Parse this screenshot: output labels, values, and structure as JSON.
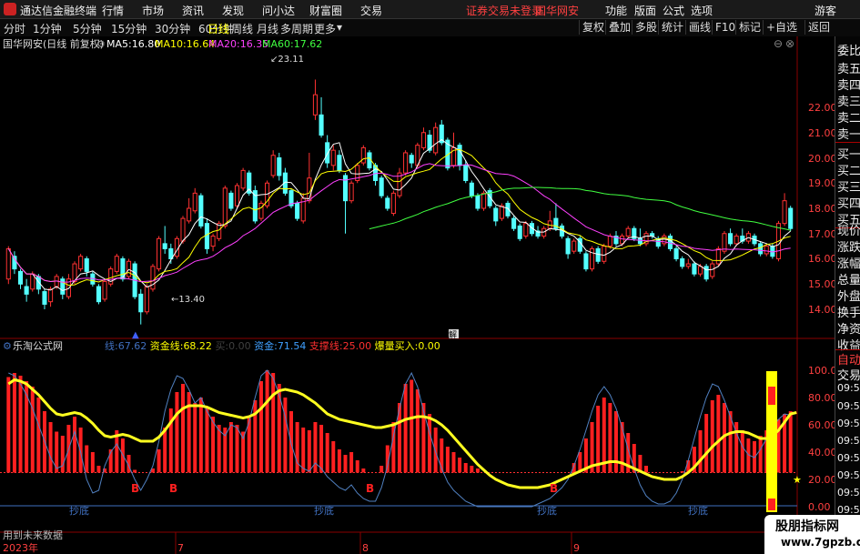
{
  "menubar": {
    "app_title": "通达信金融终端",
    "menus": [
      "行情",
      "市场",
      "资讯",
      "发现",
      "问小达",
      "财富圈",
      "交易"
    ],
    "warning": "证券交易未登录",
    "stock": "国华网安",
    "right_items": [
      "功能",
      "版面",
      "公式",
      "选项"
    ],
    "guest": "游客"
  },
  "periods": [
    "分时",
    "1分钟",
    "5分钟",
    "15分钟",
    "30分钟",
    "60分钟",
    "日线",
    "周线",
    "月线",
    "多周期",
    "更多"
  ],
  "active_period": "日线",
  "tools": [
    "复权",
    "叠加",
    "多股",
    "统计",
    "画线",
    "F10",
    "标记",
    "+自选",
    "返回"
  ],
  "main_panel": {
    "title": "国华网安(日线 前复权)",
    "ma": [
      {
        "label": "MA5:",
        "value": "16.80",
        "color": "#ffffff"
      },
      {
        "label": "MA10:",
        "value": "16.64",
        "color": "#ffff00"
      },
      {
        "label": "MA20:",
        "value": "16.35",
        "color": "#ff40ff"
      },
      {
        "label": "MA60:",
        "value": "17.62",
        "color": "#40ff40"
      }
    ],
    "high_label": "23.11",
    "low_label": "13.40",
    "marker": "解",
    "axis_ticks": [
      "22.00",
      "21.00",
      "20.00",
      "19.00",
      "18.00",
      "17.00",
      "16.00",
      "15.00",
      "14.00"
    ]
  },
  "sub_panel": {
    "title": "乐淘公式网",
    "indicators": [
      {
        "label": "线:",
        "value": "67.62",
        "color": "#4070c0"
      },
      {
        "label": "资金线:",
        "value": "68.22",
        "color": "#ffff00"
      },
      {
        "label": "买:",
        "value": "0.00",
        "color": "#404040"
      },
      {
        "label": "资金:",
        "value": "71.54",
        "color": "#40a0ff"
      },
      {
        "label": "支撑线:",
        "value": "25.00",
        "color": "#ff3030"
      },
      {
        "label": "爆量买入:",
        "value": "0.00",
        "color": "#ffff00"
      }
    ],
    "axis_ticks": [
      "100.00",
      "80.00",
      "60.00",
      "40.00",
      "20.00",
      "0.00"
    ],
    "b_marks": [
      "B",
      "B",
      "B",
      "B"
    ],
    "bottom_labels": [
      "抄底",
      "抄底",
      "抄底",
      "抄底"
    ],
    "future_note": "用到未来数据"
  },
  "time_axis": [
    "2023年",
    "7",
    "8",
    "9"
  ],
  "sidebar": {
    "items": [
      "委比",
      "卖五",
      "卖四",
      "卖三",
      "卖二",
      "卖一",
      "买一",
      "买二",
      "买三",
      "买四",
      "买五",
      "现价",
      "涨跌",
      "涨幅",
      "总量",
      "外盘",
      "换手",
      "净资",
      "收益"
    ],
    "lower": [
      "自动",
      "交易",
      "09:51",
      "09:51",
      "09:51",
      "09:51",
      "09:52",
      "09:52",
      "09:52",
      "09:52"
    ]
  },
  "watermark": {
    "line1": "股朋指标网",
    "line2": "www.7gpzb.com"
  },
  "chart_data": {
    "type": "candlestick",
    "candles": [
      [
        15.2,
        16.4,
        15.0,
        16.5
      ],
      [
        16.1,
        15.6,
        15.4,
        16.3
      ],
      [
        15.5,
        15.0,
        14.8,
        15.6
      ],
      [
        14.9,
        14.6,
        14.3,
        15.2
      ],
      [
        14.8,
        15.4,
        14.7,
        15.5
      ],
      [
        15.3,
        14.8,
        14.6,
        15.4
      ],
      [
        14.7,
        14.2,
        14.0,
        14.8
      ],
      [
        14.3,
        14.8,
        14.1,
        14.9
      ],
      [
        14.9,
        15.3,
        14.8,
        15.4
      ],
      [
        15.2,
        14.6,
        14.4,
        15.3
      ],
      [
        14.5,
        15.2,
        14.4,
        15.4
      ],
      [
        15.1,
        15.8,
        15.0,
        15.9
      ],
      [
        15.6,
        16.1,
        15.5,
        16.2
      ],
      [
        16.0,
        15.5,
        15.3,
        16.1
      ],
      [
        15.4,
        15.0,
        14.9,
        15.5
      ],
      [
        14.9,
        14.3,
        14.2,
        15.0
      ],
      [
        14.4,
        15.1,
        14.3,
        15.2
      ],
      [
        15.0,
        15.6,
        14.9,
        15.7
      ],
      [
        15.5,
        16.1,
        15.4,
        16.2
      ],
      [
        16.0,
        15.2,
        15.1,
        16.1
      ],
      [
        15.3,
        15.9,
        15.2,
        16.0
      ],
      [
        15.8,
        14.5,
        14.4,
        15.9
      ],
      [
        14.6,
        13.9,
        13.4,
        14.8
      ],
      [
        13.9,
        14.9,
        13.8,
        15.0
      ],
      [
        14.8,
        15.7,
        14.7,
        15.8
      ],
      [
        15.6,
        16.8,
        15.5,
        16.9
      ],
      [
        16.6,
        16.4,
        16.2,
        17.3
      ],
      [
        16.4,
        16.0,
        15.8,
        16.6
      ],
      [
        16.1,
        16.8,
        16.0,
        16.9
      ],
      [
        16.7,
        17.6,
        16.6,
        17.7
      ],
      [
        17.5,
        18.0,
        17.4,
        18.4
      ],
      [
        17.9,
        18.6,
        17.8,
        18.8
      ],
      [
        18.5,
        17.3,
        17.2,
        18.6
      ],
      [
        17.4,
        16.4,
        16.2,
        17.6
      ],
      [
        16.5,
        16.9,
        16.3,
        17.0
      ],
      [
        16.8,
        17.4,
        16.7,
        17.5
      ],
      [
        17.3,
        18.8,
        17.2,
        18.9
      ],
      [
        18.6,
        18.0,
        17.9,
        18.7
      ],
      [
        18.1,
        18.9,
        18.0,
        19.0
      ],
      [
        18.8,
        19.5,
        18.7,
        19.6
      ],
      [
        19.4,
        18.6,
        18.5,
        19.5
      ],
      [
        18.7,
        17.5,
        17.4,
        18.9
      ],
      [
        17.6,
        18.2,
        17.5,
        18.3
      ],
      [
        18.1,
        19.0,
        18.0,
        19.1
      ],
      [
        19.3,
        20.1,
        19.2,
        20.3
      ],
      [
        20.0,
        19.3,
        19.1,
        20.2
      ],
      [
        19.4,
        18.6,
        18.5,
        19.6
      ],
      [
        18.7,
        18.1,
        18.0,
        18.8
      ],
      [
        18.2,
        17.6,
        17.5,
        18.3
      ],
      [
        17.5,
        18.4,
        17.4,
        18.6
      ],
      [
        18.3,
        19.2,
        18.2,
        20.2
      ],
      [
        21.7,
        22.5,
        21.5,
        23.1
      ],
      [
        21.7,
        20.9,
        20.8,
        22.4
      ],
      [
        20.6,
        19.8,
        19.6,
        20.9
      ],
      [
        19.7,
        20.3,
        19.5,
        20.5
      ],
      [
        20.1,
        19.5,
        19.4,
        20.3
      ],
      [
        19.3,
        18.3,
        17.0,
        19.4
      ],
      [
        18.3,
        19.0,
        18.2,
        19.1
      ],
      [
        19.1,
        19.7,
        19.0,
        19.8
      ],
      [
        19.8,
        20.4,
        19.7,
        20.5
      ],
      [
        20.2,
        19.6,
        19.5,
        20.3
      ],
      [
        19.7,
        19.1,
        18.9,
        19.8
      ],
      [
        19.2,
        18.5,
        18.4,
        19.3
      ],
      [
        18.4,
        18.0,
        17.9,
        18.5
      ],
      [
        17.8,
        18.6,
        17.7,
        18.7
      ],
      [
        18.5,
        19.4,
        18.4,
        19.6
      ],
      [
        19.4,
        20.2,
        19.3,
        20.3
      ],
      [
        20.1,
        19.8,
        19.6,
        20.2
      ],
      [
        19.7,
        20.5,
        19.6,
        20.6
      ],
      [
        20.4,
        21.0,
        20.3,
        21.2
      ],
      [
        20.9,
        20.3,
        20.2,
        21.1
      ],
      [
        20.2,
        21.2,
        20.1,
        21.4
      ],
      [
        21.3,
        20.6,
        20.5,
        21.5
      ],
      [
        20.7,
        19.6,
        19.5,
        20.8
      ],
      [
        19.7,
        20.4,
        19.6,
        21.0
      ],
      [
        20.5,
        19.7,
        19.5,
        20.6
      ],
      [
        19.7,
        19.1,
        19.0,
        19.9
      ],
      [
        19.0,
        18.5,
        18.4,
        19.1
      ],
      [
        18.5,
        18.0,
        17.9,
        18.6
      ],
      [
        18.0,
        18.6,
        17.9,
        18.7
      ],
      [
        18.7,
        18.1,
        18.0,
        18.8
      ],
      [
        18.0,
        17.5,
        17.3,
        18.1
      ],
      [
        17.6,
        18.1,
        17.5,
        18.2
      ],
      [
        18.2,
        17.7,
        17.6,
        18.3
      ],
      [
        17.6,
        17.2,
        17.1,
        17.7
      ],
      [
        17.3,
        16.8,
        16.7,
        17.4
      ],
      [
        16.9,
        17.4,
        16.8,
        17.5
      ],
      [
        17.4,
        17.0,
        16.9,
        17.5
      ],
      [
        17.1,
        16.9,
        16.8,
        17.3
      ],
      [
        16.9,
        17.2,
        16.8,
        17.3
      ],
      [
        17.2,
        17.5,
        17.1,
        17.9
      ],
      [
        17.6,
        17.2,
        17.1,
        18.2
      ],
      [
        17.3,
        16.9,
        16.8,
        17.4
      ],
      [
        16.8,
        16.2,
        16.0,
        16.9
      ],
      [
        16.3,
        16.7,
        16.2,
        16.8
      ],
      [
        16.8,
        16.3,
        16.2,
        16.9
      ],
      [
        16.2,
        15.6,
        15.5,
        16.3
      ],
      [
        15.6,
        16.4,
        15.5,
        16.5
      ],
      [
        16.4,
        15.9,
        15.8,
        16.5
      ],
      [
        15.9,
        16.5,
        15.8,
        16.6
      ],
      [
        16.5,
        16.9,
        16.4,
        17.0
      ],
      [
        16.9,
        16.6,
        16.5,
        17.1
      ],
      [
        16.6,
        16.9,
        16.5,
        17.0
      ],
      [
        16.9,
        17.2,
        16.8,
        17.3
      ],
      [
        17.2,
        16.8,
        16.7,
        17.3
      ],
      [
        16.8,
        16.6,
        16.5,
        17.2
      ],
      [
        16.6,
        17.0,
        16.5,
        17.1
      ],
      [
        17.0,
        16.9,
        16.8,
        17.1
      ],
      [
        16.8,
        16.5,
        16.4,
        16.9
      ],
      [
        16.6,
        16.9,
        16.5,
        17.0
      ],
      [
        16.9,
        16.4,
        16.3,
        17.0
      ],
      [
        16.4,
        16.0,
        15.9,
        16.5
      ],
      [
        16.0,
        15.7,
        15.6,
        16.1
      ],
      [
        15.7,
        15.8,
        15.6,
        16.0
      ],
      [
        15.8,
        15.4,
        15.3,
        15.9
      ],
      [
        15.4,
        15.7,
        15.3,
        15.8
      ],
      [
        15.7,
        15.2,
        15.1,
        15.8
      ],
      [
        15.3,
        15.8,
        15.2,
        15.9
      ],
      [
        15.8,
        16.4,
        15.7,
        16.5
      ],
      [
        16.3,
        17.0,
        16.2,
        17.1
      ],
      [
        17.0,
        16.6,
        16.5,
        17.2
      ],
      [
        16.6,
        16.9,
        16.5,
        17.0
      ],
      [
        16.9,
        16.7,
        16.6,
        17.2
      ],
      [
        16.7,
        17.0,
        16.6,
        17.1
      ],
      [
        16.9,
        16.6,
        16.5,
        17.0
      ],
      [
        16.6,
        16.2,
        16.1,
        16.7
      ],
      [
        16.2,
        16.5,
        16.1,
        16.6
      ],
      [
        16.5,
        16.1,
        16.0,
        16.6
      ],
      [
        16.0,
        17.4,
        15.9,
        17.5
      ],
      [
        17.4,
        18.3,
        17.3,
        18.6
      ],
      [
        18.0,
        17.2,
        17.1,
        18.1
      ]
    ],
    "y_range": [
      13.0,
      23.8
    ],
    "ma_lines": [
      {
        "name": "MA5",
        "color": "#ffffff"
      },
      {
        "name": "MA10",
        "color": "#ffff00"
      },
      {
        "name": "MA20",
        "color": "#ff40ff"
      },
      {
        "name": "MA60",
        "color": "#40ff40"
      }
    ],
    "indicator": {
      "red_bars": [
        95,
        98,
        96,
        92,
        88,
        80,
        70,
        62,
        55,
        52,
        60,
        66,
        58,
        45,
        40,
        30,
        28,
        42,
        56,
        50,
        38,
        27,
        20,
        25,
        28,
        42,
        58,
        72,
        84,
        90,
        84,
        76,
        80,
        72,
        66,
        60,
        58,
        62,
        60,
        55,
        65,
        78,
        92,
        100,
        98,
        90,
        80,
        70,
        62,
        58,
        56,
        62,
        60,
        54,
        48,
        42,
        38,
        40,
        34,
        28,
        24,
        22,
        30,
        45,
        62,
        76,
        90,
        93,
        86,
        76,
        68,
        58,
        50,
        44,
        40,
        36,
        32,
        30,
        28,
        24,
        20,
        18,
        16,
        14,
        12,
        10,
        8,
        6,
        6,
        8,
        10,
        14,
        18,
        24,
        32,
        40,
        50,
        62,
        74,
        80,
        76,
        70,
        62,
        54,
        46,
        38,
        30,
        24,
        20,
        18,
        16,
        20,
        26,
        34,
        44,
        56,
        68,
        78,
        82,
        76,
        70,
        62,
        56,
        50,
        48,
        52,
        56,
        60,
        64,
        68,
        70
      ],
      "yellow_line": [
        90,
        93,
        92,
        90,
        86,
        82,
        77,
        72,
        68,
        67,
        68,
        69,
        68,
        65,
        61,
        56,
        52,
        51,
        52,
        53,
        52,
        50,
        48,
        48,
        48,
        51,
        56,
        62,
        68,
        72,
        74,
        74,
        74,
        73,
        71,
        69,
        68,
        67,
        66,
        65,
        66,
        68,
        72,
        77,
        82,
        85,
        86,
        85,
        84,
        82,
        79,
        76,
        72,
        68,
        66,
        64,
        63,
        62,
        61,
        60,
        59,
        58,
        58,
        59,
        60,
        62,
        64,
        65,
        66,
        66,
        65,
        63,
        60,
        56,
        51,
        46,
        41,
        36,
        31,
        27,
        23,
        20,
        18,
        16,
        15,
        14,
        14,
        14,
        14,
        15,
        16,
        18,
        20,
        22,
        24,
        26,
        28,
        30,
        31,
        32,
        33,
        33,
        32,
        30,
        28,
        26,
        24,
        22,
        21,
        20,
        20,
        20,
        22,
        25,
        29,
        34,
        39,
        44,
        48,
        52,
        54,
        55,
        55,
        54,
        52,
        50,
        50,
        52,
        56,
        62,
        68,
        69
      ],
      "blue_line": [
        98,
        96,
        90,
        82,
        72,
        60,
        48,
        36,
        28,
        30,
        42,
        55,
        40,
        20,
        10,
        12,
        30,
        40,
        46,
        38,
        30,
        20,
        12,
        20,
        30,
        48,
        70,
        86,
        96,
        94,
        86,
        76,
        80,
        70,
        62,
        56,
        52,
        60,
        58,
        50,
        62,
        80,
        96,
        100,
        94,
        82,
        66,
        46,
        32,
        28,
        26,
        32,
        28,
        22,
        18,
        14,
        12,
        16,
        10,
        6,
        4,
        4,
        14,
        30,
        52,
        72,
        90,
        98,
        88,
        70,
        54,
        40,
        28,
        18,
        12,
        8,
        4,
        2,
        0,
        0,
        0,
        0,
        0,
        0,
        0,
        0,
        0,
        0,
        2,
        4,
        6,
        10,
        14,
        20,
        30,
        42,
        56,
        70,
        82,
        88,
        82,
        72,
        58,
        42,
        28,
        16,
        8,
        4,
        2,
        2,
        4,
        10,
        20,
        34,
        50,
        66,
        80,
        90,
        88,
        78,
        66,
        54,
        44,
        38,
        36,
        42,
        50,
        58,
        64,
        68,
        67
      ],
      "support": 25,
      "y_range": [
        0,
        108
      ]
    }
  }
}
